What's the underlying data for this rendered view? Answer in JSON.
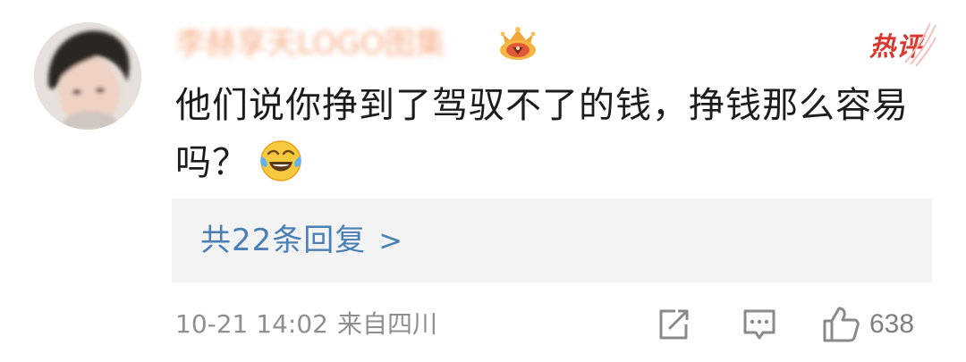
{
  "comment": {
    "username": "李赫享天LOGO图集",
    "badge_icon": "crown-medal-icon",
    "hot_tag": "热评",
    "text": "他们说你挣到了驾驭不了的钱，挣钱那么容易吗？",
    "emoji": "laugh-cry-emoji-icon",
    "replies": {
      "label": "共22条回复",
      "arrow": ">"
    },
    "meta": {
      "time": "10-21 14:02",
      "location": "来自四川"
    },
    "actions": {
      "share_icon": "share-icon",
      "comment_icon": "comment-icon",
      "like_icon": "thumbs-up-icon",
      "like_count": "638"
    }
  },
  "colors": {
    "link_blue": "#4a7fb6",
    "hot_red": "#d8382f",
    "meta_gray": "#8f8f8f",
    "reply_bg": "#f3f3f3"
  }
}
